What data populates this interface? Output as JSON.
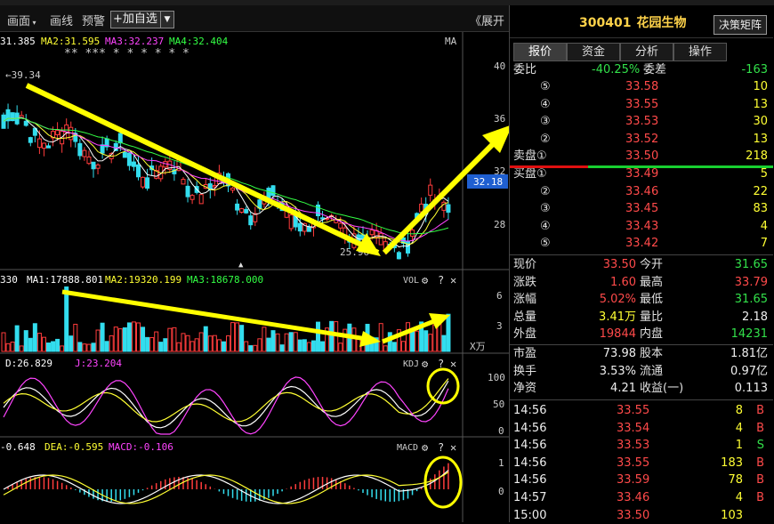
{
  "toolbar": {
    "huamian": "画面",
    "huaxian": "画线",
    "yujing": "预警",
    "add_watch": "+加自选",
    "dropdown": "▼",
    "expand": "《展开"
  },
  "main_chart": {
    "ma1": "31.385",
    "ma2": "MA2:31.595",
    "ma3": "MA3:32.237",
    "ma4": "MA4:32.404",
    "indicator_name": "MA",
    "high_label": "←39.34",
    "low_label": "25.96",
    "current_price": "32.18",
    "y_ticks": [
      "40",
      "36",
      "32",
      "28"
    ],
    "markers": "** *** *       * * * * *"
  },
  "vol_chart": {
    "vol": "330",
    "ma1": "MA1:17888.801",
    "ma2": "MA2:19320.199",
    "ma3": "MA3:18678.000",
    "name": "VOL",
    "y_ticks": [
      "6",
      "3"
    ],
    "unit": "X万"
  },
  "kdj_chart": {
    "d": "D:26.829",
    "j": "J:23.204",
    "name": "KDJ",
    "y_ticks": [
      "100",
      "50",
      "0"
    ]
  },
  "macd_chart": {
    "dif": "-0.648",
    "dea": "DEA:-0.595",
    "macd": "MACD:-0.106",
    "name": "MACD",
    "y_ticks": [
      "1",
      "0"
    ]
  },
  "panel_icons": {
    "settings": "⚙",
    "help": "?",
    "close": "✕"
  },
  "quote": {
    "code": "300401",
    "name": "花园生物",
    "decision_button": "决策矩阵",
    "tabs": [
      "报价",
      "资金",
      "分析",
      "操作"
    ],
    "weibi_label": "委比",
    "weibi_value": "-40.25%",
    "weicha_label": "委差",
    "weicha_value": "-163",
    "sell": [
      {
        "label": "⑤",
        "price": "33.58",
        "vol": "10"
      },
      {
        "label": "④",
        "price": "33.55",
        "vol": "13"
      },
      {
        "label": "③",
        "price": "33.53",
        "vol": "30"
      },
      {
        "label": "②",
        "price": "33.52",
        "vol": "13"
      },
      {
        "label": "卖盘①",
        "price": "33.50",
        "vol": "218"
      }
    ],
    "buy": [
      {
        "label": "买盘①",
        "price": "33.49",
        "vol": "5"
      },
      {
        "label": "②",
        "price": "33.46",
        "vol": "22"
      },
      {
        "label": "③",
        "price": "33.45",
        "vol": "83"
      },
      {
        "label": "④",
        "price": "33.43",
        "vol": "4"
      },
      {
        "label": "⑤",
        "price": "33.42",
        "vol": "7"
      }
    ],
    "stats": [
      {
        "l1": "现价",
        "v1": "33.50",
        "c1": "red",
        "l2": "今开",
        "v2": "31.65",
        "c2": "green"
      },
      {
        "l1": "涨跌",
        "v1": "1.60",
        "c1": "red",
        "l2": "最高",
        "v2": "33.79",
        "c2": "red"
      },
      {
        "l1": "涨幅",
        "v1": "5.02%",
        "c1": "red",
        "l2": "最低",
        "v2": "31.65",
        "c2": "green"
      },
      {
        "l1": "总量",
        "v1": "3.41万",
        "c1": "yellow",
        "l2": "量比",
        "v2": "2.18",
        "c2": "white"
      },
      {
        "l1": "外盘",
        "v1": "19844",
        "c1": "red",
        "l2": "内盘",
        "v2": "14231",
        "c2": "green"
      }
    ],
    "fundamentals": [
      {
        "l1": "市盈",
        "v1": "73.98",
        "l2": "股本",
        "v2": "1.81亿"
      },
      {
        "l1": "换手",
        "v1": "3.53%",
        "l2": "流通",
        "v2": "0.97亿"
      },
      {
        "l1": "净资",
        "v1": "4.21",
        "l2": "收益(一)",
        "v2": "0.113"
      }
    ],
    "ticks": [
      {
        "time": "14:56",
        "price": "33.55",
        "vol": "8",
        "side": "B"
      },
      {
        "time": "14:56",
        "price": "33.54",
        "vol": "4",
        "side": "B"
      },
      {
        "time": "14:56",
        "price": "33.53",
        "vol": "1",
        "side": "S"
      },
      {
        "time": "14:56",
        "price": "33.55",
        "vol": "183",
        "side": "B"
      },
      {
        "time": "14:56",
        "price": "33.59",
        "vol": "78",
        "side": "B"
      },
      {
        "time": "14:57",
        "price": "33.46",
        "vol": "4",
        "side": "B"
      },
      {
        "time": "15:00",
        "price": "33.50",
        "vol": "103",
        "side": ""
      }
    ]
  }
}
